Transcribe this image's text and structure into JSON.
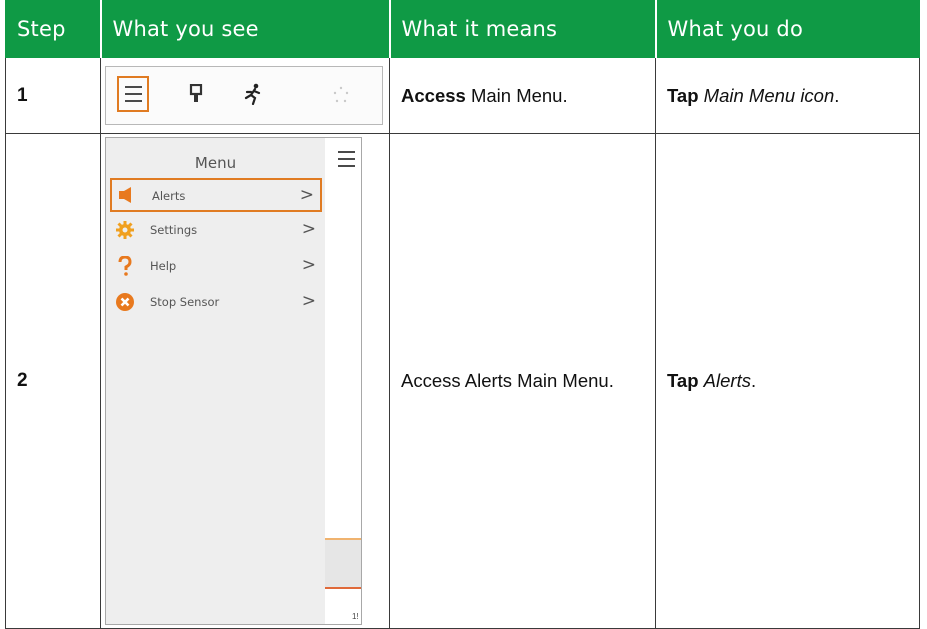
{
  "headers": {
    "step": "Step",
    "see": "What you see",
    "means": "What it means",
    "do": "What you do"
  },
  "rows": [
    {
      "step": "1",
      "means_bold": "Access",
      "means_rest": " Main Menu.",
      "do_bold": "Tap",
      "do_italic": "Main Menu icon",
      "do_end": ".",
      "screenshot": {
        "icons": [
          "menu-icon",
          "sensor-icon",
          "activity-icon",
          "loading-icon"
        ]
      }
    },
    {
      "step": "2",
      "means_text": "Access Alerts Main Menu.",
      "do_bold": "Tap",
      "do_italic": "Alerts",
      "do_end": ".",
      "screenshot": {
        "menu_title": "Menu",
        "menu_items": [
          {
            "label": "Alerts",
            "icon": "speaker-icon",
            "color": "#e8791e",
            "highlighted": true
          },
          {
            "label": "Settings",
            "icon": "gear-icon",
            "color": "#f0a020"
          },
          {
            "label": "Help",
            "icon": "help-icon",
            "color": "#e8791e"
          },
          {
            "label": "Stop Sensor",
            "icon": "stop-icon",
            "color": "#e8791e"
          }
        ],
        "side_number": "1!"
      }
    }
  ],
  "colors": {
    "header_bg": "#0f9a45",
    "accent": "#e07b22"
  }
}
